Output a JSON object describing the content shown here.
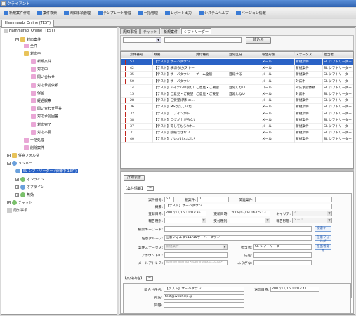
{
  "window": {
    "title": "クライアント"
  },
  "toolbar": [
    {
      "label": "新規案件作成",
      "color": "#3a7bd5"
    },
    {
      "label": "案件検索",
      "color": "#3a7bd5"
    },
    {
      "label": "周知事項管理",
      "color": "#3a7bd5"
    },
    {
      "label": "テンプレート管理",
      "color": "#3a7bd5"
    },
    {
      "label": "一括管理",
      "color": "#3a7bd5"
    },
    {
      "label": "レポート出力",
      "color": "#3a7bd5"
    },
    {
      "label": "システムヘルプ",
      "color": "#3a7bd5"
    },
    {
      "label": "バージョン情報",
      "color": "#3a7bd5"
    }
  ],
  "app_tab": "Hammurabi Online (TEST)",
  "tree": {
    "root": "Hammurabi Online (TEST)",
    "items": [
      {
        "label": "対応案件",
        "icon": "folder-icon",
        "level": 1
      },
      {
        "label": "全件",
        "icon": "pink",
        "level": 2
      },
      {
        "label": "対応中",
        "icon": "folder-icon",
        "level": 2
      },
      {
        "label": "新規案件",
        "icon": "pink",
        "level": 3
      },
      {
        "label": "対応中",
        "icon": "pink",
        "level": 3
      },
      {
        "label": "問い合わせ",
        "icon": "pink",
        "level": 3
      },
      {
        "label": "対応承認依頼",
        "icon": "pink",
        "level": 3
      },
      {
        "label": "保留",
        "icon": "pink",
        "level": 3
      },
      {
        "label": "経過観察",
        "icon": "pink",
        "level": 3
      },
      {
        "label": "問い合わせ回答",
        "icon": "pink",
        "level": 3
      },
      {
        "label": "対応承認回答",
        "icon": "pink",
        "level": 3
      },
      {
        "label": "対応完了",
        "icon": "pink",
        "level": 3
      },
      {
        "label": "対応不要",
        "icon": "pink",
        "level": 3
      },
      {
        "label": "一括処理",
        "icon": "pink",
        "level": 2
      },
      {
        "label": "削除案件",
        "icon": "pink",
        "level": 2
      },
      {
        "label": "任意フォルダ",
        "icon": "folder-icon",
        "level": 0
      },
      {
        "label": "メンバー",
        "icon": "blue",
        "level": 0
      },
      {
        "label": "SL シフトリーダー (待機中 13件)",
        "icon": "blue",
        "level": 1,
        "selected": true
      },
      {
        "label": "オンライン",
        "icon": "green",
        "level": 1
      },
      {
        "label": "オフライン",
        "icon": "blue",
        "level": 1
      },
      {
        "label": "無効",
        "icon": "green",
        "level": 1
      },
      {
        "label": "チャット",
        "icon": "green",
        "level": 0
      },
      {
        "label": "周知事項",
        "icon": "doc",
        "level": 0
      }
    ]
  },
  "right_tabs": [
    "周知事項",
    "チャット",
    "新規案件",
    "シフトリーダー"
  ],
  "filter": {
    "narrow_button": "絞込み"
  },
  "grid": {
    "columns": [
      "案件番号",
      "概要",
      "受付種別",
      "遅延区分",
      "報告形態",
      "ステータス",
      "担当者"
    ],
    "rows": [
      {
        "no": "53",
        "summary": "【テスト】サーバダウン",
        "type": "",
        "delay": "",
        "report": "メール",
        "status": "新規案件",
        "owner": "SL シフトリーダー",
        "mark": true,
        "selected": true
      },
      {
        "no": "42",
        "summary": "【テスト】横切らせ(ストー...",
        "type": "",
        "delay": "",
        "report": "メール",
        "status": "新規案件",
        "owner": "SL シフトリーダー",
        "mark": true
      },
      {
        "no": "35",
        "summary": "【テスト】サーバダウン",
        "type": "ゲーム全般",
        "delay": "遅延する",
        "report": "メール",
        "status": "新規案件",
        "owner": "SL シフトリーダー",
        "mark": true
      },
      {
        "no": "50",
        "summary": "【テスト】サーバダウン",
        "type": "",
        "delay": "",
        "report": "メール",
        "status": "対応中",
        "owner": "SL シフトリーダー",
        "mark": true
      },
      {
        "no": "14",
        "summary": "【テスト】アイテムの取りロ...",
        "type": "ご意見・ご要望",
        "delay": "遅延しない",
        "report": "コール",
        "status": "対応承認依頼",
        "owner": "SL シフトリーダー",
        "mark": false
      },
      {
        "no": "15",
        "summary": "【テスト】ご意見・ご要望",
        "type": "ご意見・ご要望",
        "delay": "遅延しない",
        "report": "メール",
        "status": "対応中",
        "owner": "SL シフトリーダー",
        "mark": false
      },
      {
        "no": "28",
        "summary": "【テスト】ご要望(新料エ...",
        "type": "",
        "delay": "",
        "report": "メール",
        "status": "新規案件",
        "owner": "SL シフトリーダー",
        "mark": true
      },
      {
        "no": "36",
        "summary": "【テスト】MSが久しいた...",
        "type": "",
        "delay": "",
        "report": "メール",
        "status": "新規案件",
        "owner": "SL シフトリーダー",
        "mark": true
      },
      {
        "no": "32",
        "summary": "【テスト】ロブインがト...",
        "type": "",
        "delay": "",
        "report": "メール",
        "status": "新規案件",
        "owner": "SL シフトリーダー",
        "mark": true
      },
      {
        "no": "38",
        "summary": "【テスト】ログが上がらない",
        "type": "",
        "delay": "",
        "report": "メール",
        "status": "新規案件",
        "owner": "SL シフトリーダー",
        "mark": true
      },
      {
        "no": "37",
        "summary": "【テスト】得してもらわれ...",
        "type": "",
        "delay": "",
        "report": "メール",
        "status": "新規案件",
        "owner": "SL シフトリーダー",
        "mark": true
      },
      {
        "no": "31",
        "summary": "【テスト】接続できない",
        "type": "",
        "delay": "",
        "report": "メール",
        "status": "新規案件",
        "owner": "SL シフトリーダー",
        "mark": true
      },
      {
        "no": "40",
        "summary": "【テスト】いいかげんにしろ...",
        "type": "",
        "delay": "",
        "report": "メール",
        "status": "新規案件",
        "owner": "SL シフトリーダー",
        "mark": true
      }
    ]
  },
  "detail": {
    "show_button": "詳細表示",
    "case_info_label": "【案件情報】",
    "case_no_label": "案件番号:",
    "case_no": "53",
    "parent_label": "親案件:",
    "parent": "0",
    "related_label": "関連案件:",
    "related": "",
    "summary_label": "概要:",
    "summary": "【テスト】サーバダウン",
    "registered_label": "登録日時:",
    "registered": "2007/11/16 11:07:35",
    "updated_label": "更新日時:",
    "updated": "2008/03/04 16:05:13",
    "carrier_label": "キャリア:",
    "carrier": "PC",
    "report_type_label": "報告種別:",
    "report_type": "",
    "receipt_type_label": "受付種別:",
    "receipt_type": "",
    "report_form_label": "報告形態:",
    "report_form": "メール",
    "keyword_label": "検索キーワード:",
    "keyword": "",
    "keyword_button": "検索キー",
    "group_label": "任意グループ:",
    "group": "任意フォルダ¥11/15サーバーダウン",
    "group_button": "任意フォルダ",
    "status_label": "案件ステータス:",
    "status": "新規案件",
    "owner_label": "担当者:",
    "owner": "SL シフトリーダー",
    "owner_button": "担当者変更",
    "account_label": "アカウントID:",
    "account": "",
    "name_label": "氏名:",
    "name": "",
    "mail_label": "メールアドレス:",
    "mail": "Sashiro Sashiro <sashiro@xxx.co.jp>",
    "kana_label": "ふりがな:",
    "kana": "",
    "content_label": "【案件内容】",
    "inq_name_label": "問合せ件名:",
    "inq_name": "【テスト】サーバダウン",
    "sent_label": "送信日時:",
    "sent": "2007/11/16 11:03:41",
    "to_label": "宛先:",
    "to": "test@webhelp.jp",
    "cc_label": "同報:",
    "cc": ""
  },
  "colors": {
    "selection": "#2a62c5",
    "mark": "#c0261e",
    "pink_node": "#e9a7d6"
  }
}
